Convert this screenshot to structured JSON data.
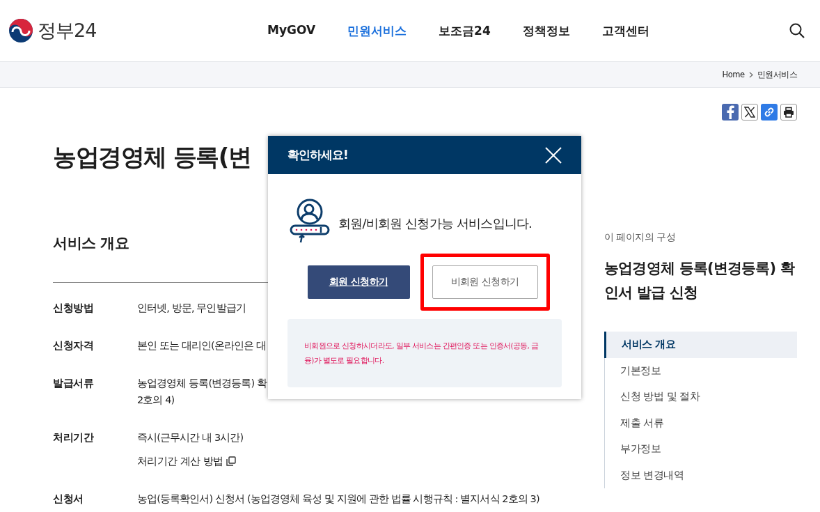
{
  "header": {
    "logo": "정부24",
    "nav": [
      {
        "label": "MyGOV",
        "selected": false
      },
      {
        "label": "민원서비스",
        "selected": true
      },
      {
        "label": "보조금24",
        "selected": false
      },
      {
        "label": "정책정보",
        "selected": false
      },
      {
        "label": "고객센터",
        "selected": false
      }
    ]
  },
  "breadcrumb": [
    "Home",
    "민원서비스"
  ],
  "page_title": "농업경영체 등록(변",
  "section_title": "서비스 개요",
  "details": [
    {
      "label": "신청방법",
      "lines": [
        "인터넷, 방문, 무인발급기"
      ]
    },
    {
      "label": "신청자격",
      "lines": [
        "본인 또는 대리인(온라인은 대"
      ]
    },
    {
      "label": "발급서류",
      "lines": [
        "농업경영체 등록(변경등록) 확",
        "2호의 4)"
      ]
    },
    {
      "label": "처리기간",
      "lines": [
        "즉시(근무시간 내 3시간)"
      ],
      "link": "처리기간 계산 방법"
    },
    {
      "label": "신청서",
      "lines": [
        "농업(등록확인서) 신청서 (농업경영체 육성 및 지원에 관한 법률 시행규칙 : 별지서식 2호의 3)"
      ]
    }
  ],
  "toc": {
    "caption": "이 페이지의 구성",
    "title": "농업경영체 등록(변경등록) 확인서 발급 신청",
    "items": [
      {
        "label": "서비스 개요",
        "selected": true
      },
      {
        "label": "기본정보",
        "selected": false
      },
      {
        "label": "신청 방법 및 절차",
        "selected": false
      },
      {
        "label": "제출 서류",
        "selected": false
      },
      {
        "label": "부가정보",
        "selected": false
      },
      {
        "label": "정보 변경내역",
        "selected": false
      }
    ]
  },
  "modal": {
    "title": "확인하세요!",
    "message": "회원/비회원 신청가능 서비스입니다.",
    "buttons": [
      {
        "label": "회원 신청하기",
        "kind": "primary",
        "highlighted": false
      },
      {
        "label": "비회원 신청하기",
        "kind": "secondary",
        "highlighted": true
      }
    ],
    "notice": "비회원으로 신청하시더라도, 일부 서비스는 간편인증 또는 인증서(공동, 금융)가 별도로 필요합니다."
  }
}
